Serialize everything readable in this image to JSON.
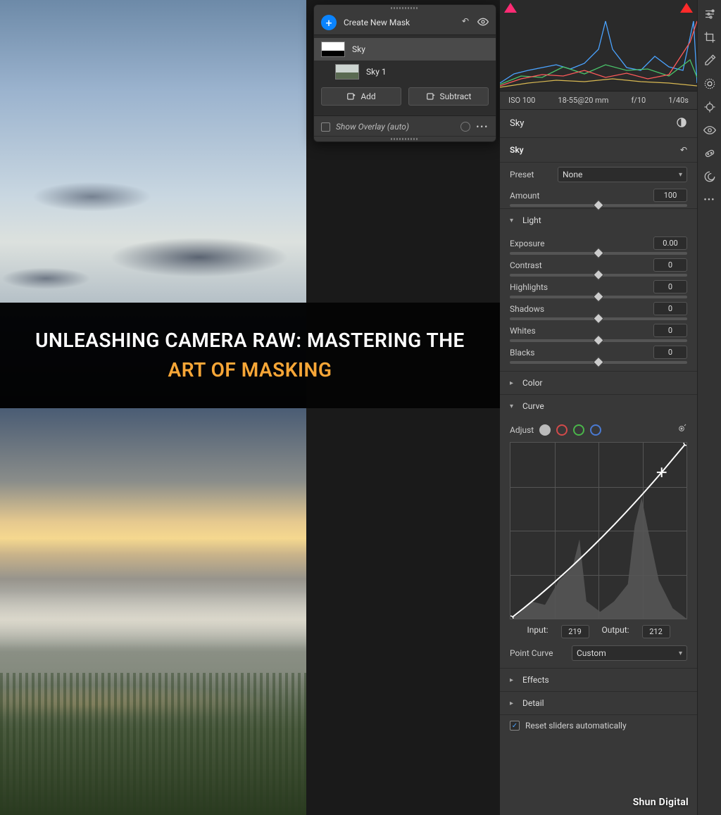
{
  "overlay": {
    "title_line1": "UNLEASHING CAMERA RAW: MASTERING THE",
    "title_line2": "ART OF MASKING"
  },
  "mask_panel": {
    "create_label": "Create New Mask",
    "masks": [
      {
        "name": "Sky"
      },
      {
        "name": "Sky 1"
      }
    ],
    "add_label": "Add",
    "subtract_label": "Subtract",
    "overlay_label": "Show Overlay (auto)"
  },
  "metadata": {
    "iso": "ISO 100",
    "lens": "18-55@20 mm",
    "aperture": "f/10",
    "shutter": "1/40s"
  },
  "mask_header": {
    "title": "Sky"
  },
  "mask_sub": {
    "title": "Sky"
  },
  "preset": {
    "label": "Preset",
    "value": "None"
  },
  "amount": {
    "label": "Amount",
    "value": "100"
  },
  "sections": {
    "light": "Light",
    "color": "Color",
    "curve": "Curve",
    "effects": "Effects",
    "detail": "Detail"
  },
  "light": {
    "exposure": {
      "label": "Exposure",
      "value": "0.00",
      "pos": 50
    },
    "contrast": {
      "label": "Contrast",
      "value": "0",
      "pos": 50
    },
    "highlights": {
      "label": "Highlights",
      "value": "0",
      "pos": 50
    },
    "shadows": {
      "label": "Shadows",
      "value": "0",
      "pos": 50
    },
    "whites": {
      "label": "Whites",
      "value": "0",
      "pos": 50
    },
    "blacks": {
      "label": "Blacks",
      "value": "0",
      "pos": 50
    }
  },
  "curve": {
    "adjust_label": "Adjust",
    "input_label": "Input:",
    "input_value": "219",
    "output_label": "Output:",
    "output_value": "212",
    "point_curve_label": "Point Curve",
    "point_curve_value": "Custom"
  },
  "footer": {
    "reset_label": "Reset sliders automatically"
  },
  "watermark": "Shun Digital",
  "tools": [
    "edit",
    "crop",
    "eyedrop",
    "radial",
    "target",
    "eye",
    "heal",
    "swirl",
    "more"
  ],
  "chart_data": {
    "type": "line",
    "title": "Tone Curve",
    "xlabel": "Input",
    "ylabel": "Output",
    "xlim": [
      0,
      255
    ],
    "ylim": [
      0,
      255
    ],
    "series": [
      {
        "name": "curve",
        "x": [
          0,
          128,
          219,
          255
        ],
        "y": [
          0,
          100,
          212,
          255
        ]
      }
    ],
    "sampled_point": {
      "input": 219,
      "output": 212
    }
  }
}
